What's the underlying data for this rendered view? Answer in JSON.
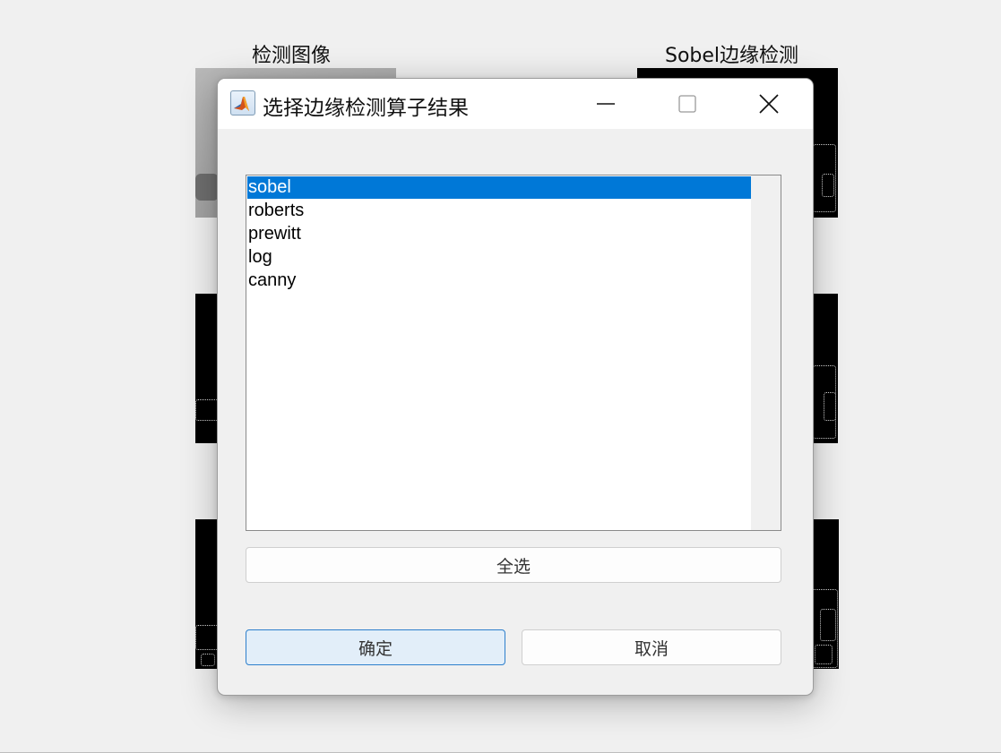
{
  "background_figure": {
    "titles": {
      "input_image": "检测图像",
      "sobel": "Sobel边缘检测"
    }
  },
  "dialog": {
    "title": "选择边缘检测算子结果",
    "app_icon": "matlab-icon",
    "window_controls": [
      "minimize-icon",
      "maximize-icon",
      "close-icon"
    ],
    "listbox": {
      "items": [
        "sobel",
        "roberts",
        "prewitt",
        "log",
        "canny"
      ],
      "selected": "sobel"
    },
    "buttons": {
      "select_all": "全选",
      "ok": "确定",
      "cancel": "取消"
    }
  },
  "colors": {
    "selection": "#0078d7",
    "ok_button_border": "#2d7fcc",
    "ok_button_fill": "#e2eef9"
  }
}
